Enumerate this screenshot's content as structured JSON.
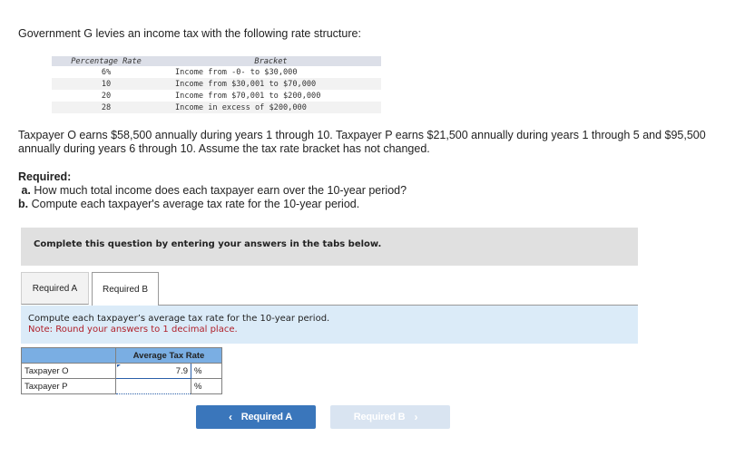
{
  "intro": "Government G levies an income tax with the following rate structure:",
  "rate_table": {
    "headers": [
      "Percentage Rate",
      "Bracket"
    ],
    "rows": [
      {
        "rate": "6%",
        "bracket": "Income from -0- to $30,000"
      },
      {
        "rate": "10",
        "bracket": "Income from $30,001 to $70,000"
      },
      {
        "rate": "20",
        "bracket": "Income from $70,001 to $200,000"
      },
      {
        "rate": "28",
        "bracket": "Income in excess of $200,000"
      }
    ]
  },
  "paragraph": "Taxpayer O earns $58,500 annually during years 1 through 10. Taxpayer P earns $21,500 annually during years 1 through 5 and $95,500 annually during years 6 through 10. Assume the tax rate bracket has not changed.",
  "required": {
    "heading": "Required:",
    "items": [
      {
        "letter": "a.",
        "text": "How much total income does each taxpayer earn over the 10-year period?"
      },
      {
        "letter": "b.",
        "text": "Compute each taxpayer's average tax rate for the 10-year period."
      }
    ]
  },
  "instruction_panel": "Complete this question by entering your answers in the tabs below.",
  "tabs": [
    {
      "label": "Required A",
      "active": false
    },
    {
      "label": "Required B",
      "active": true
    }
  ],
  "tab_content": {
    "prompt": "Compute each taxpayer’s average tax rate for the 10-year period.",
    "note": "Note: Round your answers to 1 decimal place."
  },
  "answer_table": {
    "header": "Average Tax Rate",
    "rows": [
      {
        "label": "Taxpayer O",
        "value": "7.9",
        "unit": "%"
      },
      {
        "label": "Taxpayer P",
        "value": "",
        "unit": "%"
      }
    ]
  },
  "nav": {
    "prev_label": "Required A",
    "next_label": "Required B",
    "prev_icon": "‹",
    "next_icon": "›"
  }
}
